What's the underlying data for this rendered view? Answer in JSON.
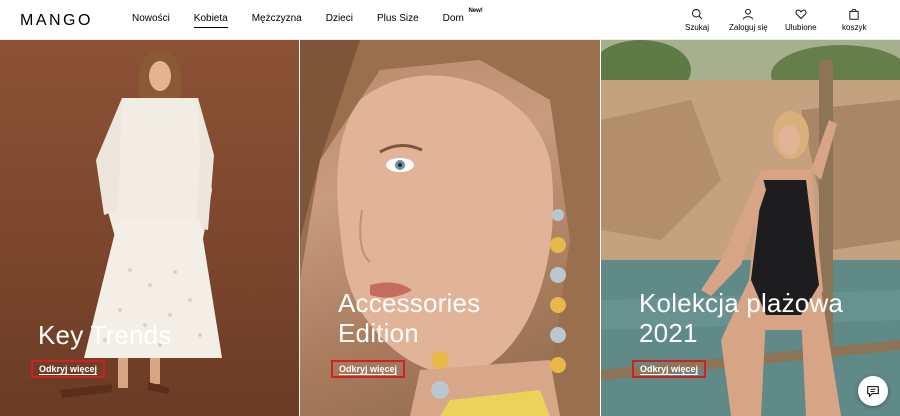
{
  "header": {
    "logo": "MANGO",
    "nav": [
      {
        "label": "Nowości",
        "active": false
      },
      {
        "label": "Kobieta",
        "active": true
      },
      {
        "label": "Mężczyzna",
        "active": false
      },
      {
        "label": "Dzieci",
        "active": false
      },
      {
        "label": "Plus Size",
        "active": false
      },
      {
        "label": "Dom",
        "active": false,
        "badge": "New!"
      }
    ],
    "actions": {
      "search": "Szukaj",
      "login": "Zaloguj się",
      "favorites": "Ulubione",
      "cart": "koszyk"
    }
  },
  "panels": [
    {
      "title": "Key Trends",
      "cta": "Odkryj więcej"
    },
    {
      "title": "Accessories Edition",
      "cta": "Odkryj więcej"
    },
    {
      "title": "Kolekcja plażowa 2021",
      "cta": "Odkryj więcej"
    }
  ],
  "colors": {
    "accent_outline": "#d21f1f",
    "panel1_bg": "#8c5236",
    "text_on_image": "#ffffff"
  }
}
